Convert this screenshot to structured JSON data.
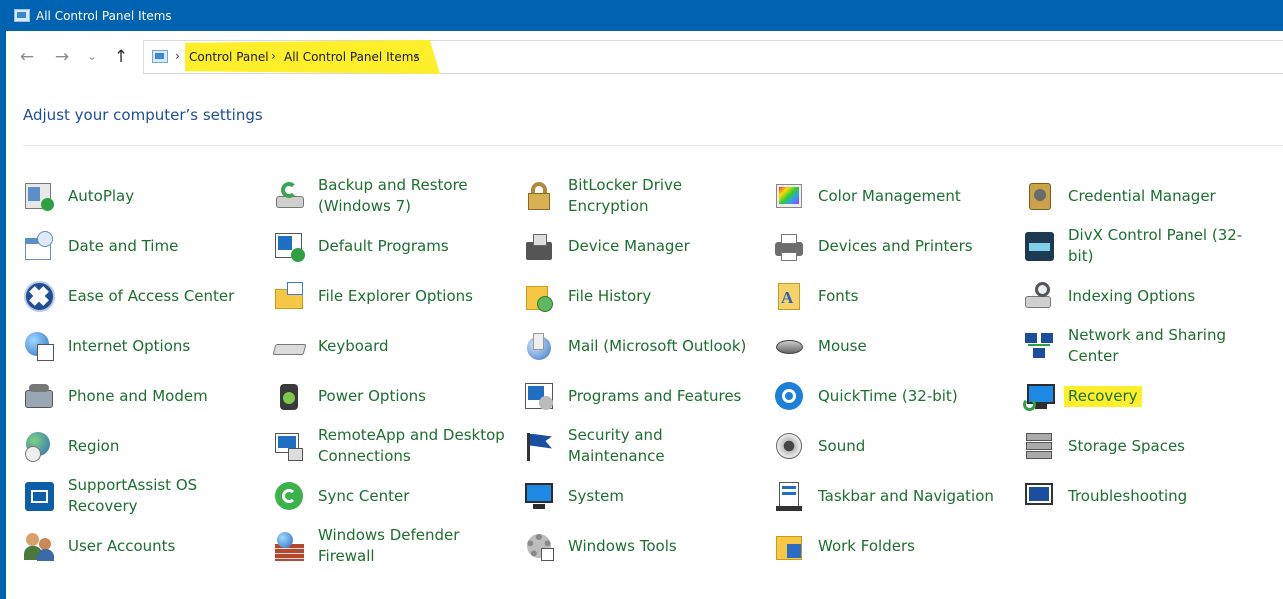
{
  "window": {
    "title": "All Control Panel Items"
  },
  "nav": {
    "back_icon": "arrow-left-icon",
    "forward_icon": "arrow-right-icon",
    "recent_icon": "chevron-down-icon",
    "up_icon": "arrow-up-icon"
  },
  "breadcrumb": {
    "items": [
      "Control Panel",
      "All Control Panel Items"
    ],
    "separator": "›"
  },
  "heading": "Adjust your computer’s settings",
  "colors": {
    "title_bar": "#0063b1",
    "item_text": "#1c6f2e",
    "heading": "#1e4e9c",
    "highlight": "#ffef2a"
  },
  "items": [
    {
      "label": "AutoPlay",
      "icon": "autoplay-icon"
    },
    {
      "label": "Backup and Restore (Windows 7)",
      "icon": "backup-icon"
    },
    {
      "label": "BitLocker Drive Encryption",
      "icon": "bitlocker-icon"
    },
    {
      "label": "Color Management",
      "icon": "color-management-icon"
    },
    {
      "label": "Credential Manager",
      "icon": "credential-manager-icon"
    },
    {
      "label": "Date and Time",
      "icon": "date-time-icon"
    },
    {
      "label": "Default Programs",
      "icon": "default-programs-icon"
    },
    {
      "label": "Device Manager",
      "icon": "device-manager-icon"
    },
    {
      "label": "Devices and Printers",
      "icon": "printer-icon"
    },
    {
      "label": "DivX Control Panel (32-bit)",
      "icon": "divx-icon"
    },
    {
      "label": "Ease of Access Center",
      "icon": "ease-of-access-icon"
    },
    {
      "label": "File Explorer Options",
      "icon": "folder-options-icon"
    },
    {
      "label": "File History",
      "icon": "file-history-icon"
    },
    {
      "label": "Fonts",
      "icon": "fonts-icon"
    },
    {
      "label": "Indexing Options",
      "icon": "indexing-icon"
    },
    {
      "label": "Internet Options",
      "icon": "internet-options-icon"
    },
    {
      "label": "Keyboard",
      "icon": "keyboard-icon"
    },
    {
      "label": "Mail (Microsoft Outlook)",
      "icon": "mail-icon"
    },
    {
      "label": "Mouse",
      "icon": "mouse-icon"
    },
    {
      "label": "Network and Sharing Center",
      "icon": "network-icon"
    },
    {
      "label": "Phone and Modem",
      "icon": "phone-modem-icon"
    },
    {
      "label": "Power Options",
      "icon": "power-icon"
    },
    {
      "label": "Programs and Features",
      "icon": "programs-features-icon"
    },
    {
      "label": "QuickTime (32-bit)",
      "icon": "quicktime-icon"
    },
    {
      "label": "Recovery",
      "icon": "recovery-icon",
      "highlighted": true
    },
    {
      "label": "Region",
      "icon": "region-icon"
    },
    {
      "label": "RemoteApp and Desktop Connections",
      "icon": "remoteapp-icon"
    },
    {
      "label": "Security and Maintenance",
      "icon": "security-flag-icon"
    },
    {
      "label": "Sound",
      "icon": "sound-icon"
    },
    {
      "label": "Storage Spaces",
      "icon": "storage-spaces-icon"
    },
    {
      "label": "SupportAssist OS Recovery",
      "icon": "supportassist-icon"
    },
    {
      "label": "Sync Center",
      "icon": "sync-icon"
    },
    {
      "label": "System",
      "icon": "system-icon"
    },
    {
      "label": "Taskbar and Navigation",
      "icon": "taskbar-icon"
    },
    {
      "label": "Troubleshooting",
      "icon": "troubleshooting-icon"
    },
    {
      "label": "User Accounts",
      "icon": "user-accounts-icon"
    },
    {
      "label": "Windows Defender Firewall",
      "icon": "firewall-icon"
    },
    {
      "label": "Windows Tools",
      "icon": "windows-tools-icon"
    },
    {
      "label": "Work Folders",
      "icon": "work-folders-icon"
    }
  ]
}
